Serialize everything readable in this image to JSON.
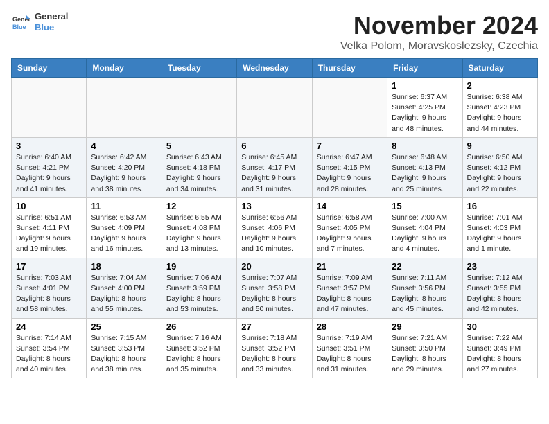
{
  "logo": {
    "line1": "General",
    "line2": "Blue"
  },
  "header": {
    "month": "November 2024",
    "location": "Velka Polom, Moravskoslezsky, Czechia"
  },
  "weekdays": [
    "Sunday",
    "Monday",
    "Tuesday",
    "Wednesday",
    "Thursday",
    "Friday",
    "Saturday"
  ],
  "weeks": [
    [
      {
        "day": "",
        "info": ""
      },
      {
        "day": "",
        "info": ""
      },
      {
        "day": "",
        "info": ""
      },
      {
        "day": "",
        "info": ""
      },
      {
        "day": "",
        "info": ""
      },
      {
        "day": "1",
        "info": "Sunrise: 6:37 AM\nSunset: 4:25 PM\nDaylight: 9 hours\nand 48 minutes."
      },
      {
        "day": "2",
        "info": "Sunrise: 6:38 AM\nSunset: 4:23 PM\nDaylight: 9 hours\nand 44 minutes."
      }
    ],
    [
      {
        "day": "3",
        "info": "Sunrise: 6:40 AM\nSunset: 4:21 PM\nDaylight: 9 hours\nand 41 minutes."
      },
      {
        "day": "4",
        "info": "Sunrise: 6:42 AM\nSunset: 4:20 PM\nDaylight: 9 hours\nand 38 minutes."
      },
      {
        "day": "5",
        "info": "Sunrise: 6:43 AM\nSunset: 4:18 PM\nDaylight: 9 hours\nand 34 minutes."
      },
      {
        "day": "6",
        "info": "Sunrise: 6:45 AM\nSunset: 4:17 PM\nDaylight: 9 hours\nand 31 minutes."
      },
      {
        "day": "7",
        "info": "Sunrise: 6:47 AM\nSunset: 4:15 PM\nDaylight: 9 hours\nand 28 minutes."
      },
      {
        "day": "8",
        "info": "Sunrise: 6:48 AM\nSunset: 4:13 PM\nDaylight: 9 hours\nand 25 minutes."
      },
      {
        "day": "9",
        "info": "Sunrise: 6:50 AM\nSunset: 4:12 PM\nDaylight: 9 hours\nand 22 minutes."
      }
    ],
    [
      {
        "day": "10",
        "info": "Sunrise: 6:51 AM\nSunset: 4:11 PM\nDaylight: 9 hours\nand 19 minutes."
      },
      {
        "day": "11",
        "info": "Sunrise: 6:53 AM\nSunset: 4:09 PM\nDaylight: 9 hours\nand 16 minutes."
      },
      {
        "day": "12",
        "info": "Sunrise: 6:55 AM\nSunset: 4:08 PM\nDaylight: 9 hours\nand 13 minutes."
      },
      {
        "day": "13",
        "info": "Sunrise: 6:56 AM\nSunset: 4:06 PM\nDaylight: 9 hours\nand 10 minutes."
      },
      {
        "day": "14",
        "info": "Sunrise: 6:58 AM\nSunset: 4:05 PM\nDaylight: 9 hours\nand 7 minutes."
      },
      {
        "day": "15",
        "info": "Sunrise: 7:00 AM\nSunset: 4:04 PM\nDaylight: 9 hours\nand 4 minutes."
      },
      {
        "day": "16",
        "info": "Sunrise: 7:01 AM\nSunset: 4:03 PM\nDaylight: 9 hours\nand 1 minute."
      }
    ],
    [
      {
        "day": "17",
        "info": "Sunrise: 7:03 AM\nSunset: 4:01 PM\nDaylight: 8 hours\nand 58 minutes."
      },
      {
        "day": "18",
        "info": "Sunrise: 7:04 AM\nSunset: 4:00 PM\nDaylight: 8 hours\nand 55 minutes."
      },
      {
        "day": "19",
        "info": "Sunrise: 7:06 AM\nSunset: 3:59 PM\nDaylight: 8 hours\nand 53 minutes."
      },
      {
        "day": "20",
        "info": "Sunrise: 7:07 AM\nSunset: 3:58 PM\nDaylight: 8 hours\nand 50 minutes."
      },
      {
        "day": "21",
        "info": "Sunrise: 7:09 AM\nSunset: 3:57 PM\nDaylight: 8 hours\nand 47 minutes."
      },
      {
        "day": "22",
        "info": "Sunrise: 7:11 AM\nSunset: 3:56 PM\nDaylight: 8 hours\nand 45 minutes."
      },
      {
        "day": "23",
        "info": "Sunrise: 7:12 AM\nSunset: 3:55 PM\nDaylight: 8 hours\nand 42 minutes."
      }
    ],
    [
      {
        "day": "24",
        "info": "Sunrise: 7:14 AM\nSunset: 3:54 PM\nDaylight: 8 hours\nand 40 minutes."
      },
      {
        "day": "25",
        "info": "Sunrise: 7:15 AM\nSunset: 3:53 PM\nDaylight: 8 hours\nand 38 minutes."
      },
      {
        "day": "26",
        "info": "Sunrise: 7:16 AM\nSunset: 3:52 PM\nDaylight: 8 hours\nand 35 minutes."
      },
      {
        "day": "27",
        "info": "Sunrise: 7:18 AM\nSunset: 3:52 PM\nDaylight: 8 hours\nand 33 minutes."
      },
      {
        "day": "28",
        "info": "Sunrise: 7:19 AM\nSunset: 3:51 PM\nDaylight: 8 hours\nand 31 minutes."
      },
      {
        "day": "29",
        "info": "Sunrise: 7:21 AM\nSunset: 3:50 PM\nDaylight: 8 hours\nand 29 minutes."
      },
      {
        "day": "30",
        "info": "Sunrise: 7:22 AM\nSunset: 3:49 PM\nDaylight: 8 hours\nand 27 minutes."
      }
    ]
  ]
}
